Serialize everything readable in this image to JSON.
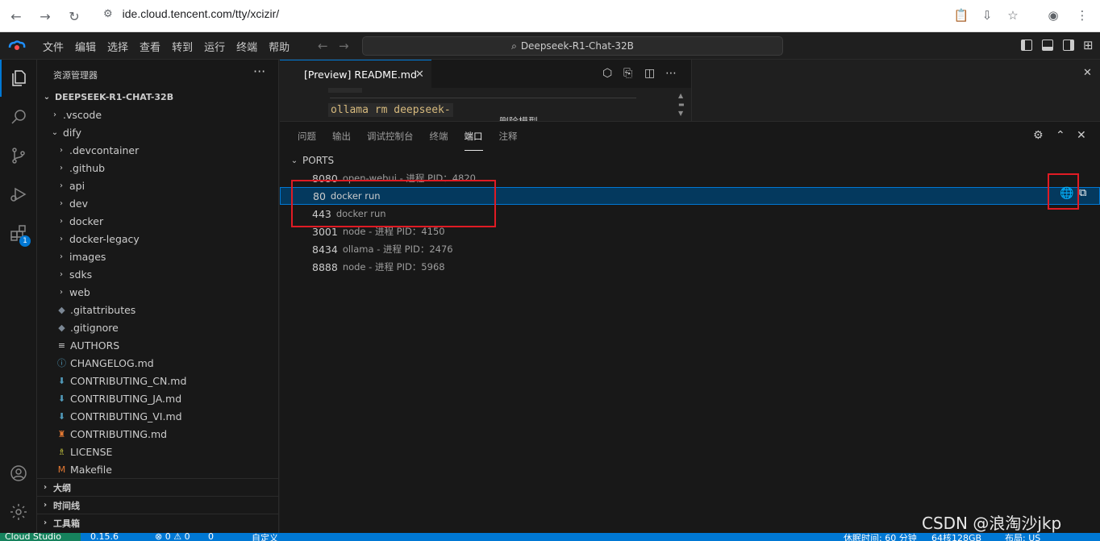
{
  "browser": {
    "url": "ide.cloud.tencent.com/tty/xcizir/"
  },
  "ide": {
    "menus": [
      "文件",
      "编辑",
      "选择",
      "查看",
      "转到",
      "运行",
      "终端",
      "帮助"
    ],
    "command_center": "Deepseek-R1-Chat-32B",
    "activity_badge": "1"
  },
  "sidebar": {
    "title": "资源管理器",
    "more": "···",
    "root": "DEEPSEEK-R1-CHAT-32B",
    "tree": [
      {
        "label": ".vscode",
        "type": "folder",
        "depth": 1,
        "open": false
      },
      {
        "label": "dify",
        "type": "folder",
        "depth": 1,
        "open": true
      },
      {
        "label": ".devcontainer",
        "type": "folder",
        "depth": 2,
        "open": false
      },
      {
        "label": ".github",
        "type": "folder",
        "depth": 2,
        "open": false
      },
      {
        "label": "api",
        "type": "folder",
        "depth": 2,
        "open": false
      },
      {
        "label": "dev",
        "type": "folder",
        "depth": 2,
        "open": false
      },
      {
        "label": "docker",
        "type": "folder",
        "depth": 2,
        "open": false
      },
      {
        "label": "docker-legacy",
        "type": "folder",
        "depth": 2,
        "open": false
      },
      {
        "label": "images",
        "type": "folder",
        "depth": 2,
        "open": false
      },
      {
        "label": "sdks",
        "type": "folder",
        "depth": 2,
        "open": false
      },
      {
        "label": "web",
        "type": "folder",
        "depth": 2,
        "open": false
      },
      {
        "label": ".gitattributes",
        "type": "git",
        "depth": 2
      },
      {
        "label": ".gitignore",
        "type": "git",
        "depth": 2
      },
      {
        "label": "AUTHORS",
        "type": "text",
        "depth": 2
      },
      {
        "label": "CHANGELOG.md",
        "type": "info",
        "depth": 2
      },
      {
        "label": "CONTRIBUTING_CN.md",
        "type": "md",
        "depth": 2
      },
      {
        "label": "CONTRIBUTING_JA.md",
        "type": "md",
        "depth": 2
      },
      {
        "label": "CONTRIBUTING_VI.md",
        "type": "md",
        "depth": 2
      },
      {
        "label": "CONTRIBUTING.md",
        "type": "contrib",
        "depth": 2
      },
      {
        "label": "LICENSE",
        "type": "license",
        "depth": 2
      },
      {
        "label": "Makefile",
        "type": "make",
        "depth": 2
      }
    ],
    "sections": [
      "大纲",
      "时间线",
      "工具箱"
    ]
  },
  "editor": {
    "tab_label": "[Preview] README.md",
    "code_snippets": [
      "ollama rm deepseek-",
      "删除模型"
    ]
  },
  "panel": {
    "tabs": [
      "问题",
      "输出",
      "调试控制台",
      "终端",
      "端口",
      "注释"
    ],
    "active_tab": "端口",
    "section": "PORTS",
    "ports": [
      {
        "port": "8080",
        "process": "open-webui - 进程 PID：4820"
      },
      {
        "port": "80",
        "process": "docker run",
        "selected": true
      },
      {
        "port": "443",
        "process": "docker run"
      },
      {
        "port": "3001",
        "process": "node - 进程 PID：4150"
      },
      {
        "port": "8434",
        "process": "ollama - 进程 PID：2476"
      },
      {
        "port": "8888",
        "process": "node - 进程 PID：5968"
      }
    ]
  },
  "statusbar": {
    "remote": "Cloud Studio",
    "version": "0.15.6",
    "problems": "⊗ 0 ⚠ 0",
    "ports": "0",
    "custom": "自定义",
    "idle": "休眠时间: 60 分钟",
    "machine": "64核128GB",
    "layout": "布局: US"
  },
  "watermark": "CSDN @浪淘沙jkp",
  "colors": {
    "accent": "#0078d4",
    "selection": "#04395e",
    "highlight_box": "#e01b24",
    "remote": "#16825d"
  }
}
